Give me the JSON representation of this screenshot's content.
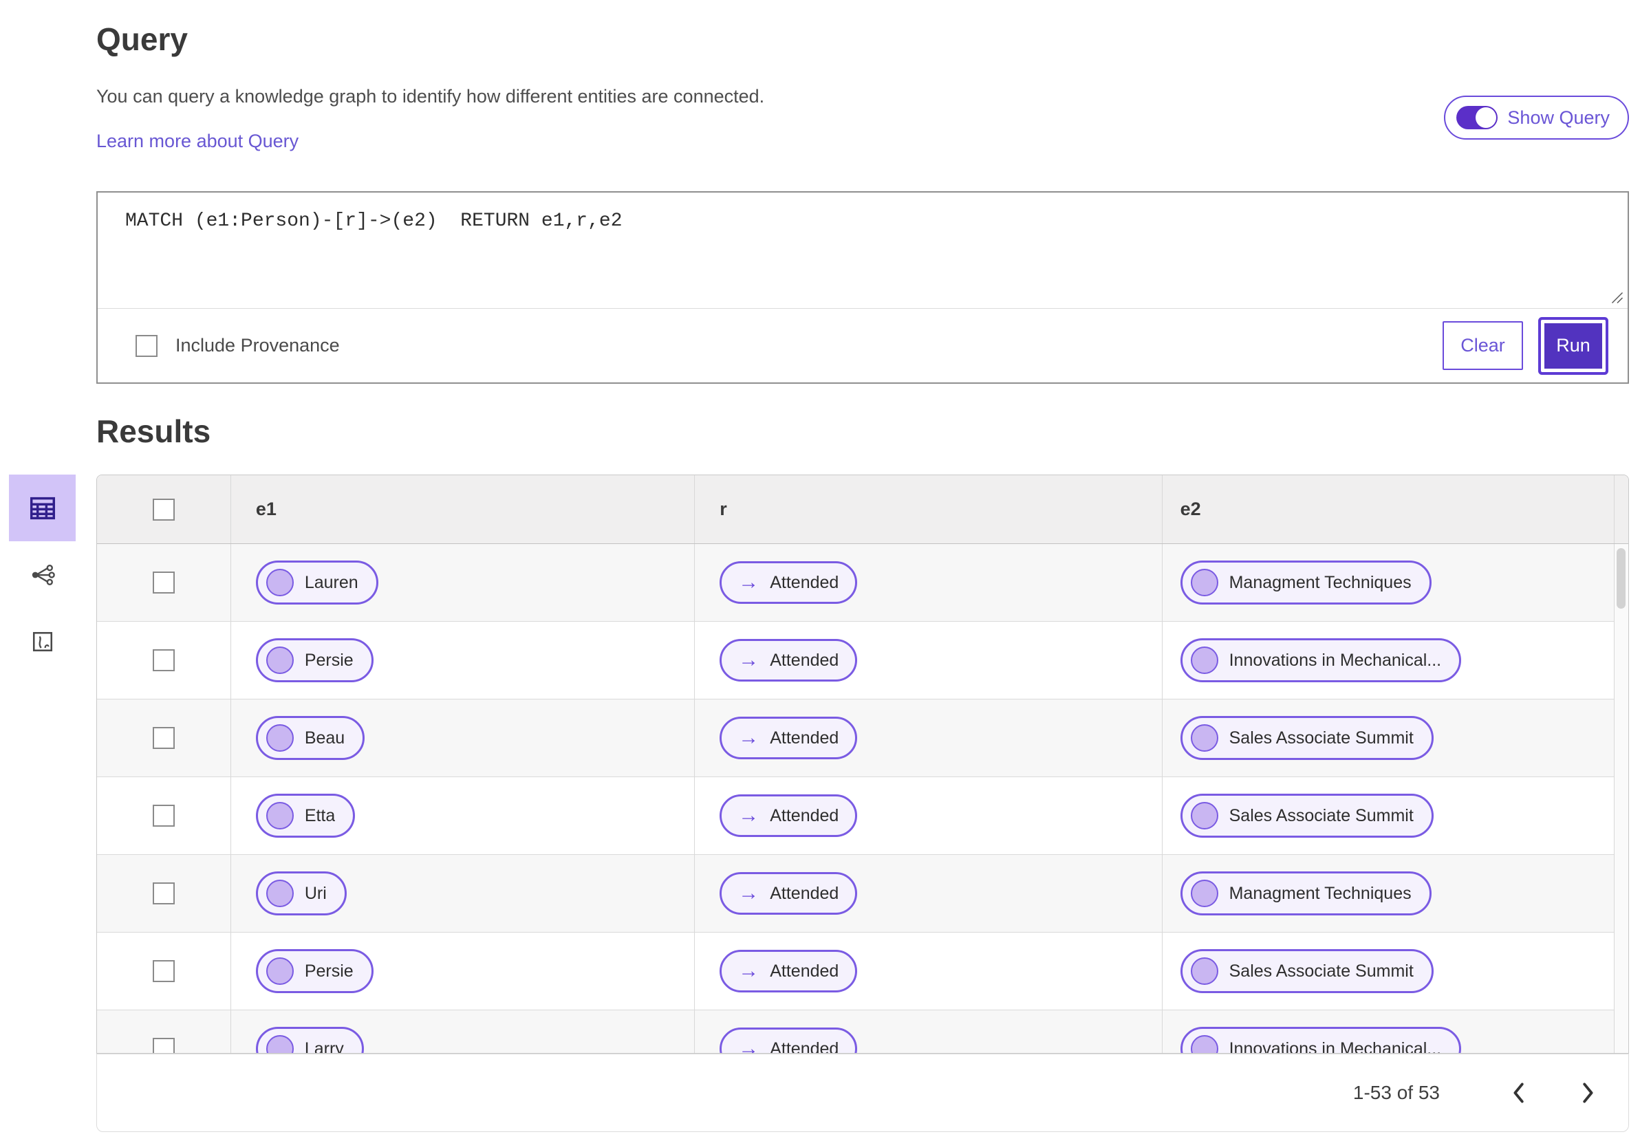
{
  "header": {
    "title": "Query",
    "description": "You can query a knowledge graph to identify how different entities are connected.",
    "learn_more": "Learn more about Query",
    "show_query_label": "Show Query",
    "show_query_on": true
  },
  "query": {
    "text": "MATCH (e1:Person)-[r]->(e2)  RETURN e1,r,e2",
    "include_provenance_label": "Include Provenance",
    "include_provenance_checked": false,
    "clear_label": "Clear",
    "run_label": "Run"
  },
  "results": {
    "title": "Results",
    "views": [
      {
        "name": "table-view",
        "icon": "table-icon",
        "selected": true
      },
      {
        "name": "graph-view",
        "icon": "share-network-icon",
        "selected": false
      },
      {
        "name": "chart-view",
        "icon": "chart-icon",
        "selected": false
      }
    ],
    "table": {
      "columns": [
        "e1",
        "r",
        "e2"
      ],
      "arrow_icon": "→",
      "rows": [
        {
          "e1": "Lauren",
          "r": "Attended",
          "e2": "Managment Techniques"
        },
        {
          "e1": "Persie",
          "r": "Attended",
          "e2": "Innovations in Mechanical..."
        },
        {
          "e1": "Beau",
          "r": "Attended",
          "e2": "Sales Associate Summit"
        },
        {
          "e1": "Etta",
          "r": "Attended",
          "e2": "Sales Associate Summit"
        },
        {
          "e1": "Uri",
          "r": "Attended",
          "e2": "Managment Techniques"
        },
        {
          "e1": "Persie",
          "r": "Attended",
          "e2": "Sales Associate Summit"
        },
        {
          "e1": "Larry",
          "r": "Attended",
          "e2": "Innovations in Mechanical..."
        }
      ]
    },
    "pagination": {
      "range_label": "1-53 of 53"
    }
  },
  "colors": {
    "accent_purple": "#5b33c7",
    "run_button_fill": "#5233bf",
    "pill_border": "#7a5be3",
    "pill_background": "#f5f2fd",
    "pill_circle_fill": "#c9b6f2",
    "selected_view_background": "#d2c4f8",
    "link_purple": "#6857d3",
    "header_row_background": "#f0efef",
    "alt_row_background": "#f7f7f7"
  }
}
